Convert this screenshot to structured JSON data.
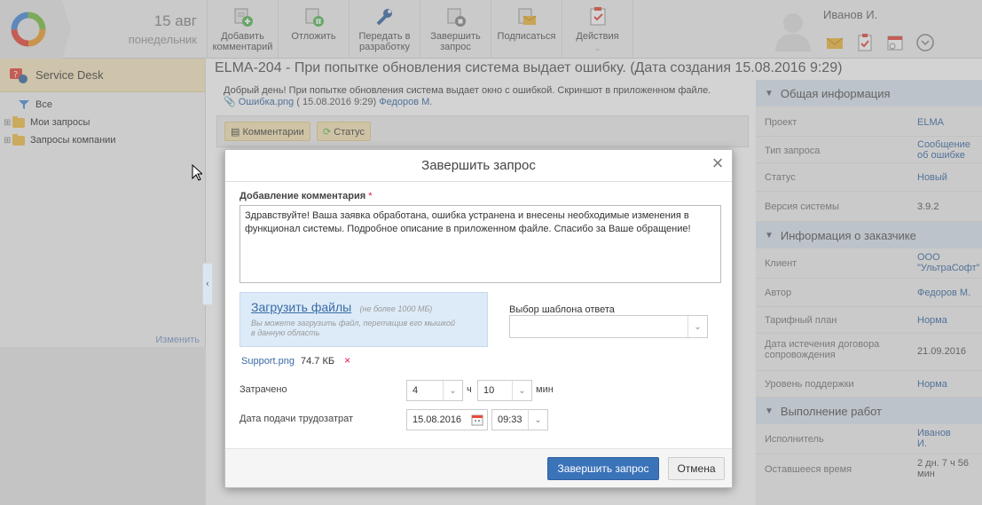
{
  "header": {
    "date_day": "15 авг",
    "date_weekday": "понедельник",
    "toolbar": [
      {
        "label": "Добавить комментарий",
        "icon": "add-comment-icon"
      },
      {
        "label": "Отложить",
        "icon": "pause-icon"
      },
      {
        "label": "Передать в разработку",
        "icon": "wrench-icon"
      },
      {
        "label": "Завершить запрос",
        "icon": "complete-request-icon"
      },
      {
        "label": "Подписаться",
        "icon": "subscribe-icon"
      },
      {
        "label": "Действия",
        "icon": "actions-icon"
      }
    ],
    "user_name": "Иванов И."
  },
  "sidebar": {
    "title": "Service Desk",
    "items": [
      {
        "label": "Все"
      },
      {
        "label": "Мои запросы"
      },
      {
        "label": "Запросы компании"
      }
    ],
    "edit_label": "Изменить"
  },
  "main": {
    "title": "ELMA-204 - При попытке обновления система выдает ошибку. (Дата создания 15.08.2016 9:29)",
    "request_text": "Добрый день! При попытке обновления система выдает окно с ошибкой. Скриншот в приложенном файле.",
    "attachment_name": "Ошибка.png",
    "attachment_date": "( 15.08.2016 9:29)",
    "attachment_author": "Федоров М.",
    "tab_comments": "Комментарии",
    "tab_status": "Статус"
  },
  "info_panel": {
    "general_title": "Общая информация",
    "general": [
      {
        "key": "Проект",
        "value": "ELMA",
        "link": true
      },
      {
        "key": "Тип запроса",
        "value": "Сообщение об ошибке",
        "link": true
      },
      {
        "key": "Статус",
        "value": "Новый",
        "link": true
      },
      {
        "key": "Версия системы",
        "value": "3.9.2",
        "link": false
      }
    ],
    "customer_title": "Информация о заказчике",
    "customer": [
      {
        "key": "Клиент",
        "value": "ООО \"УльтраСофт\"",
        "link": true
      },
      {
        "key": "Автор",
        "value": "Федоров М.",
        "link": true
      },
      {
        "key": "Тарифный план",
        "value": "Норма",
        "link": true
      },
      {
        "key": "Дата истечения договора сопровождения",
        "value": "21.09.2016",
        "link": false
      },
      {
        "key": "Уровень поддержки",
        "value": "Норма",
        "link": true
      }
    ],
    "work_title": "Выполнение работ",
    "work": [
      {
        "key": "Исполнитель",
        "value": "Иванов И.",
        "link": true
      },
      {
        "key": "Оставшееся время",
        "value": "2 дн. 7 ч 56 мин",
        "link": false
      }
    ]
  },
  "dialog": {
    "title": "Завершить запрос",
    "comment_label": "Добавление комментария",
    "required_mark": "*",
    "comment_text": "Здравствуйте! Ваша заявка обработана, ошибка устранена и внесены необходимые изменения в функционал системы. Подробное описание в приложенном файле. Спасибо за Ваше обращение!",
    "upload_link": "Загрузить файлы",
    "upload_limit": "(не более 1000 МБ)",
    "upload_hint": "Вы можете загрузить файл, перетащив его мышкой в данную область",
    "template_label": "Выбор шаблона ответа",
    "template_value": "",
    "file_name": "Support.png",
    "file_size": "74.7 КБ",
    "file_remove": "×",
    "spent_label": "Затрачено",
    "hours_value": "4",
    "hours_unit": "ч",
    "minutes_value": "10",
    "minutes_unit": "мин",
    "date_label": "Дата подачи трудозатрат",
    "date_value": "15.08.2016",
    "time_value": "09:33",
    "submit_label": "Завершить запрос",
    "cancel_label": "Отмена"
  }
}
